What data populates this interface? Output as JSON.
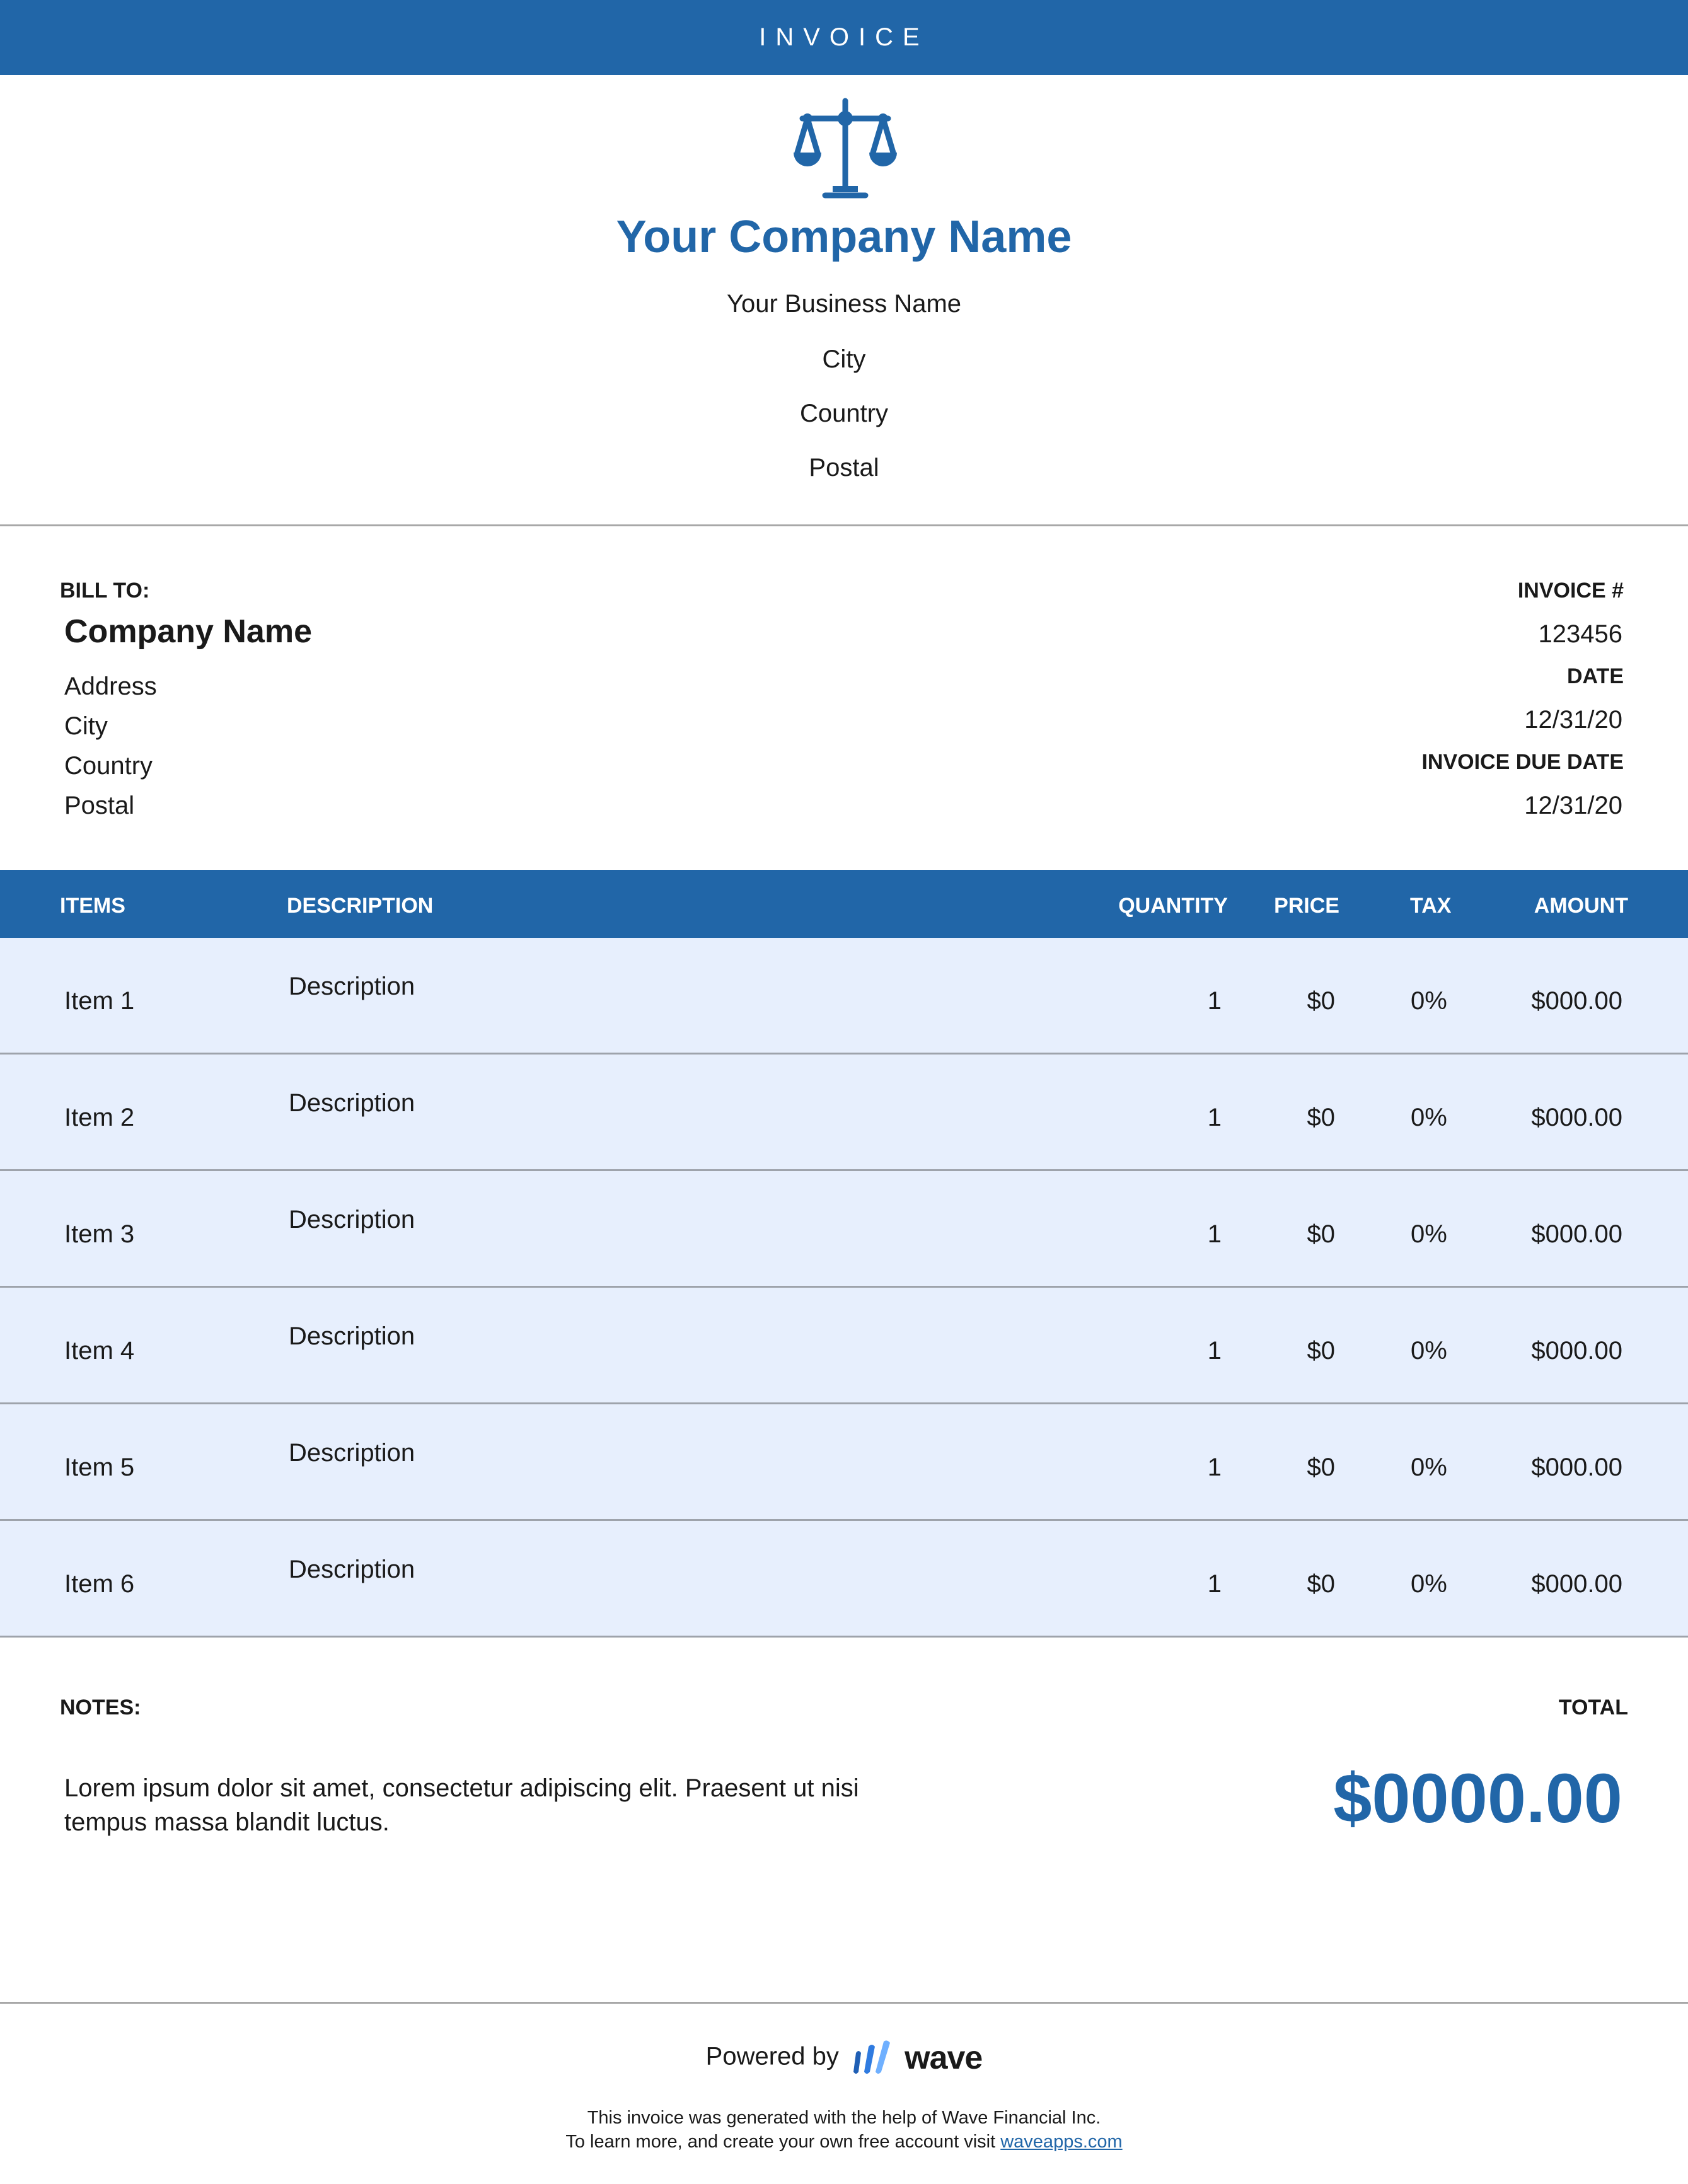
{
  "header": {
    "title": "INVOICE"
  },
  "company": {
    "name": "Your Company Name",
    "business_name": "Your Business Name",
    "city": "City",
    "country": "Country",
    "postal": "Postal"
  },
  "bill_to": {
    "label": "BILL TO:",
    "name": "Company Name",
    "address": "Address",
    "city": "City",
    "country": "Country",
    "postal": "Postal"
  },
  "invoice_meta": {
    "number_label": "INVOICE #",
    "number": "123456",
    "date_label": "DATE",
    "date": "12/31/20",
    "due_label": "INVOICE DUE DATE",
    "due_date": "12/31/20"
  },
  "table": {
    "headers": {
      "items": "ITEMS",
      "description": "DESCRIPTION",
      "quantity": "QUANTITY",
      "price": "PRICE",
      "tax": "TAX",
      "amount": "AMOUNT"
    },
    "rows": [
      {
        "item": "Item 1",
        "description": "Description",
        "quantity": "1",
        "price": "$0",
        "tax": "0%",
        "amount": "$000.00"
      },
      {
        "item": "Item 2",
        "description": "Description",
        "quantity": "1",
        "price": "$0",
        "tax": "0%",
        "amount": "$000.00"
      },
      {
        "item": "Item 3",
        "description": "Description",
        "quantity": "1",
        "price": "$0",
        "tax": "0%",
        "amount": "$000.00"
      },
      {
        "item": "Item 4",
        "description": "Description",
        "quantity": "1",
        "price": "$0",
        "tax": "0%",
        "amount": "$000.00"
      },
      {
        "item": "Item 5",
        "description": "Description",
        "quantity": "1",
        "price": "$0",
        "tax": "0%",
        "amount": "$000.00"
      },
      {
        "item": "Item 6",
        "description": "Description",
        "quantity": "1",
        "price": "$0",
        "tax": "0%",
        "amount": "$000.00"
      }
    ]
  },
  "notes": {
    "label": "NOTES:",
    "text": "Lorem ipsum dolor sit amet, consectetur adipiscing elit. Praesent ut nisi tempus massa blandit luctus."
  },
  "total": {
    "label": "TOTAL",
    "value": "$0000.00"
  },
  "footer": {
    "powered_by": "Powered by",
    "brand": "wave",
    "line1": "This invoice was generated with the help of Wave Financial Inc.",
    "line2": "To learn more, and create your own free account visit",
    "link": "waveapps.com"
  },
  "colors": {
    "brand_blue": "#2166a8",
    "row_fill": "#e7effd",
    "rule": "#a8a8a8"
  },
  "icons": {
    "logo": "scales-of-justice-icon",
    "wave_logo": "wave-logo-icon"
  }
}
